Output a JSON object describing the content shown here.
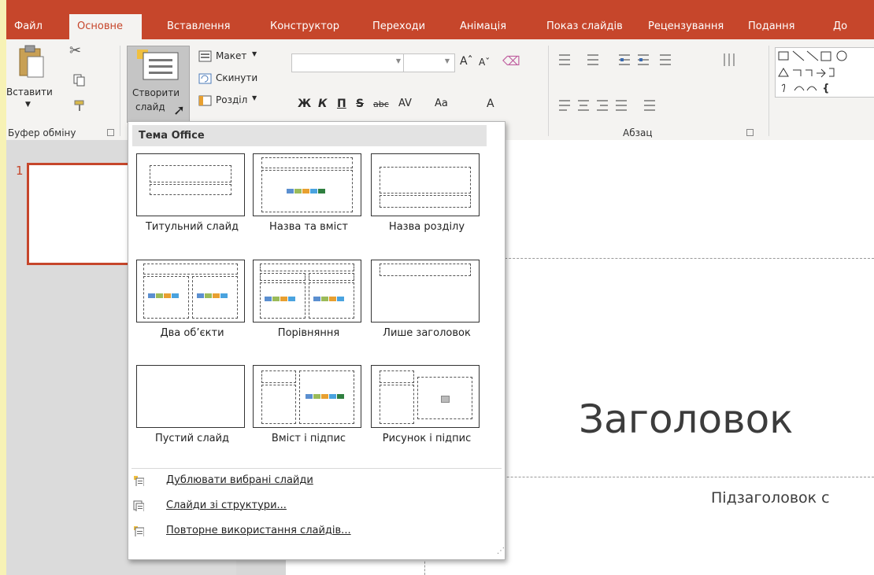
{
  "tabs": [
    {
      "label": "Файл"
    },
    {
      "label": "Основне"
    },
    {
      "label": "Вставлення"
    },
    {
      "label": "Конструктор"
    },
    {
      "label": "Переходи"
    },
    {
      "label": "Анімація"
    },
    {
      "label": "Показ слайдів"
    },
    {
      "label": "Рецензування"
    },
    {
      "label": "Подання"
    },
    {
      "label": "До"
    }
  ],
  "ribbon": {
    "paste": "Вставити",
    "clipboard_group": "Буфер обміну",
    "new_slide_line1": "Створити",
    "new_slide_line2": "слайд",
    "layout": "Макет",
    "reset": "Скинути",
    "section": "Розділ",
    "paragraph_group": "Абзац",
    "font_bold": "Ж",
    "font_italic": "К",
    "font_underline": "П",
    "font_strike": "S",
    "font_shadow": "abc",
    "font_spacing": "AV",
    "font_case": "Aa",
    "font_color": "A"
  },
  "slide_number": "1",
  "slide": {
    "title": "Заголовок",
    "subtitle": "Підзаголовок с"
  },
  "menu": {
    "header": "Тема Office",
    "layouts": [
      {
        "label": "Титульний слайд"
      },
      {
        "label": "Назва та вміст"
      },
      {
        "label": "Назва розділу"
      },
      {
        "label": "Два об’єкти"
      },
      {
        "label": "Порівняння"
      },
      {
        "label": "Лише заголовок"
      },
      {
        "label": "Пустий слайд"
      },
      {
        "label": "Вміст і підпис"
      },
      {
        "label": "Рисунок і підпис"
      }
    ],
    "commands": [
      {
        "label": "Дублювати вибрані слайди"
      },
      {
        "label": "Слайди зі структури..."
      },
      {
        "label": "Повторне використання слайдів..."
      }
    ]
  },
  "colors": {
    "accent": "#c6462b",
    "frame": "#f7f2b5"
  }
}
